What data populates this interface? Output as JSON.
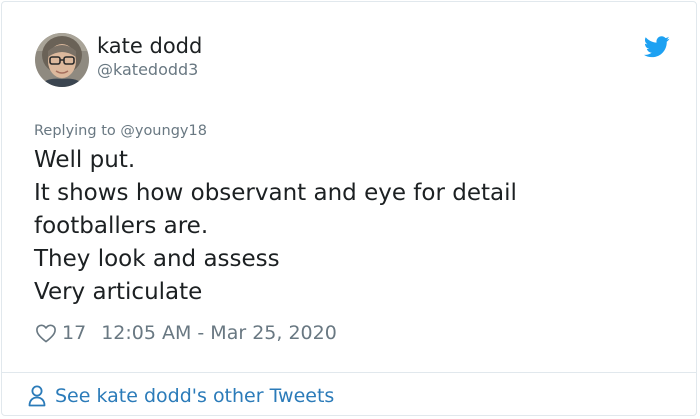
{
  "tweet": {
    "author": {
      "display_name": "kate dodd",
      "handle": "@katedodd3",
      "avatar_icon": "avatar-photo"
    },
    "reply_prefix": "Replying to ",
    "reply_to": "@youngy18",
    "text_lines": [
      "Well put.",
      "It shows how observant and eye for detail",
      "footballers are.",
      "They look and assess",
      "Very articulate"
    ],
    "likes": "17",
    "timestamp": "12:05 AM - Mar 25, 2020",
    "footer_link": "See kate dodd's other Tweets"
  },
  "icons": {
    "brand": "twitter-bird-icon",
    "like": "heart-icon",
    "profile": "person-icon"
  },
  "colors": {
    "brand_blue": "#1da1f2",
    "link_blue": "#2b7bb9",
    "text": "#1c2022",
    "muted": "#697882",
    "border": "#e1e8ed"
  }
}
